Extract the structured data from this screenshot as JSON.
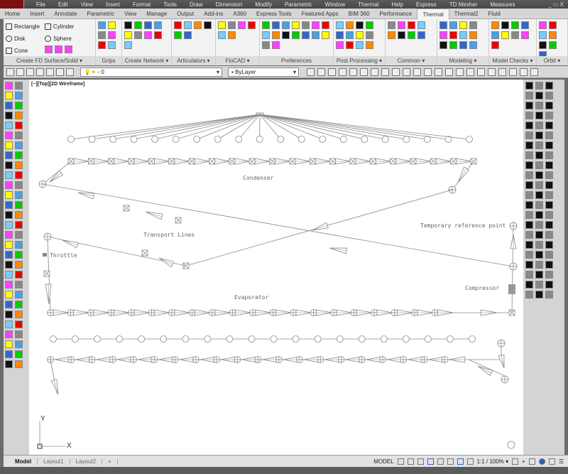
{
  "menubar": {
    "items": [
      "File",
      "Edit",
      "View",
      "Insert",
      "Format",
      "Tools",
      "Draw",
      "Dimension",
      "Modify",
      "Parametric",
      "Window",
      "Thermal",
      "Help",
      "Express",
      "TD Mesher",
      "Measures"
    ],
    "window_controls": "_ ▭ X"
  },
  "ribbon_tabs": {
    "items": [
      "Home",
      "Insert",
      "Annotate",
      "Parametric",
      "View",
      "Manage",
      "Output",
      "Add-ins",
      "A360",
      "Express Tools",
      "Featured Apps",
      "BIM 360",
      "Performance",
      "Thermal",
      "Thermal2",
      "Fluid"
    ],
    "active": "Thermal"
  },
  "ribbon": {
    "shapes": [
      "Rectangle",
      "Cylinder",
      "Disk",
      "Sphere",
      "Cone"
    ],
    "panels": [
      "Create FD Surface/Solid ▾",
      "Grips",
      "Create Network ▾",
      "Articulators ▾",
      "FloCAD ▾",
      "Preferences",
      "Post Processing ▾",
      "Common ▾",
      "Modeling ▾",
      "Model Checks ▾",
      "Orbit ▾"
    ]
  },
  "toolbar": {
    "layer_value": "0",
    "color_value": "ByLayer"
  },
  "viewport": {
    "label": "[−][Top][2D Wireframe]",
    "labels": {
      "condenser": "Condenser",
      "transport": "Transport Lines",
      "throttle": "Throttle",
      "evaporator": "Evaporator",
      "compressor": "Compressor",
      "refpoint": "Temporary reference point"
    },
    "ucs": {
      "x": "X",
      "y": "Y"
    }
  },
  "statusbar": {
    "layouts": [
      "Model",
      "Layout1",
      "Layout2",
      "+"
    ],
    "active": "Model",
    "mode": "MODEL",
    "scale": "1:1 / 100% ▾"
  },
  "colors": {
    "accent_active_tab": "#f4f4f4",
    "line": "#8a8a8a"
  }
}
